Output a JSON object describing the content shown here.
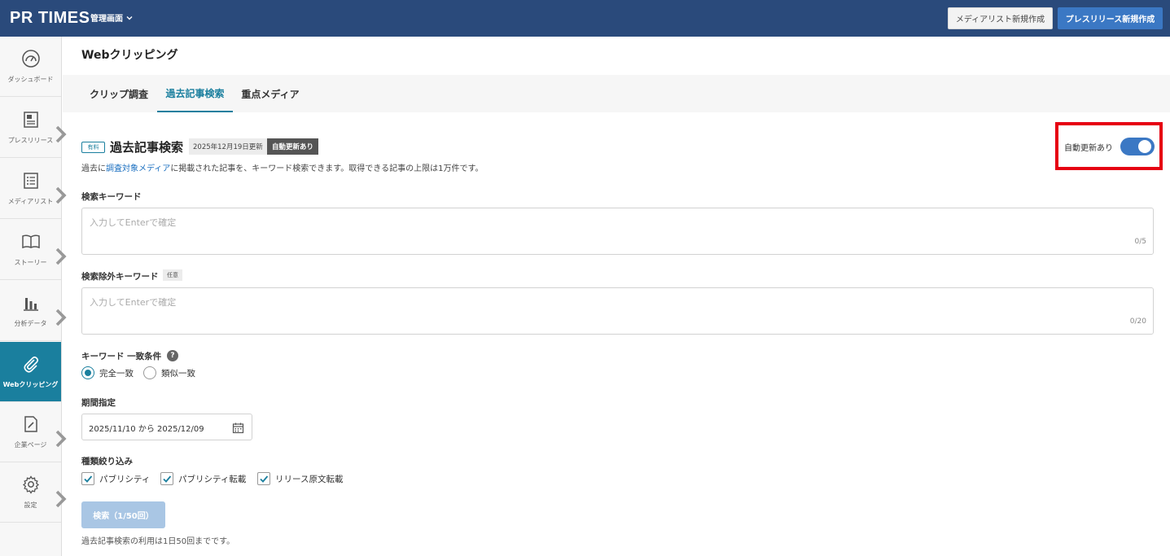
{
  "header": {
    "logo": "PR TIMES",
    "admin_menu": "管理画面",
    "media_list_button": "メディアリスト新規作成",
    "press_release_button": "プレスリリース新規作成"
  },
  "sidebar": {
    "items": [
      {
        "label": "ダッシュボード",
        "icon": "dashboard-icon"
      },
      {
        "label": "プレスリリース",
        "icon": "document-icon"
      },
      {
        "label": "メディアリスト",
        "icon": "list-icon"
      },
      {
        "label": "ストーリー",
        "icon": "book-icon"
      },
      {
        "label": "分析データ",
        "icon": "bar-chart-icon"
      },
      {
        "label": "Webクリッピング",
        "icon": "paperclip-icon",
        "active": true
      },
      {
        "label": "企業ページ",
        "icon": "edit-page-icon"
      },
      {
        "label": "設定",
        "icon": "gear-icon"
      }
    ]
  },
  "page": {
    "title": "Webクリッピング",
    "tabs": [
      {
        "label": "クリップ調査"
      },
      {
        "label": "過去記事検索",
        "active": true
      },
      {
        "label": "重点メディア"
      }
    ]
  },
  "section": {
    "paid_badge": "有料",
    "title": "過去記事検索",
    "updated": "2025年12月19日更新",
    "auto_update_tag": "自動更新あり",
    "desc_prefix": "過去に",
    "desc_link": "調査対象メディア",
    "desc_suffix": "に掲載された記事を、キーワード検索できます。取得できる記事の上限は1万件です。"
  },
  "auto_update_toggle": {
    "label": "自動更新あり",
    "on": true
  },
  "form": {
    "keyword": {
      "label": "検索キーワード",
      "placeholder": "入力してEnterで確定",
      "count": "0/5"
    },
    "exclude_keyword": {
      "label": "検索除外キーワード",
      "optional": "任意",
      "placeholder": "入力してEnterで確定",
      "count": "0/20"
    },
    "match": {
      "label": "キーワード 一致条件",
      "help": "?",
      "options": [
        {
          "label": "完全一致",
          "selected": true
        },
        {
          "label": "類似一致",
          "selected": false
        }
      ]
    },
    "period": {
      "label": "期間指定",
      "value": "2025/11/10 から 2025/12/09"
    },
    "types": {
      "label": "種類絞り込み",
      "options": [
        {
          "label": "パブリシティ",
          "checked": true
        },
        {
          "label": "パブリシティ転載",
          "checked": true
        },
        {
          "label": "リリース原文転載",
          "checked": true
        }
      ]
    },
    "search_button": "検索（1/50回）",
    "limit_note": "過去記事検索の利用は1日50回までです。"
  },
  "colors": {
    "header_bg": "#2a4a7b",
    "accent": "#1a7f9e",
    "primary_button": "#3b78c4",
    "highlight_box": "#e60012"
  }
}
